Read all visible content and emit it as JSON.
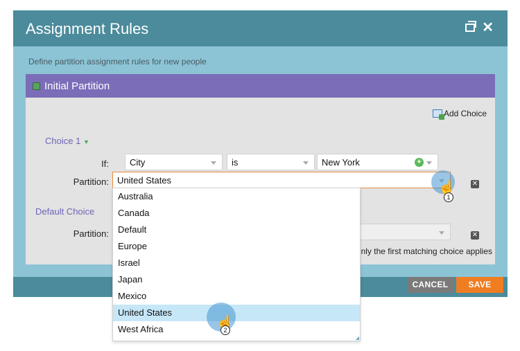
{
  "dialog": {
    "title": "Assignment Rules",
    "subtitle": "Define partition assignment rules for new people"
  },
  "panel": {
    "title": "Initial Partition",
    "add_choice": "Add Choice"
  },
  "choice1": {
    "label": "Choice 1",
    "if_label": "If:",
    "field_value": "City",
    "operator_value": "is",
    "match_value": "New York",
    "partition_label": "Partition:",
    "partition_value": "United States"
  },
  "default_choice": {
    "label": "Default Choice",
    "partition_label": "Partition:",
    "note": "nly the first matching choice applies"
  },
  "footer": {
    "cancel_label": "CANCEL",
    "save_label": "SAVE"
  },
  "dropdown": {
    "options": [
      "Australia",
      "Canada",
      "Default",
      "Europe",
      "Israel",
      "Japan",
      "Mexico",
      "United States",
      "West Africa"
    ],
    "highlighted": "United States"
  },
  "steps": {
    "step1": "1",
    "step2": "2"
  },
  "colors": {
    "titlebar": "#4b8b9b",
    "panel_header": "#7b6db8",
    "save": "#f07d22",
    "cancel": "#7a7a7a",
    "highlight": "#c6e7f7"
  }
}
